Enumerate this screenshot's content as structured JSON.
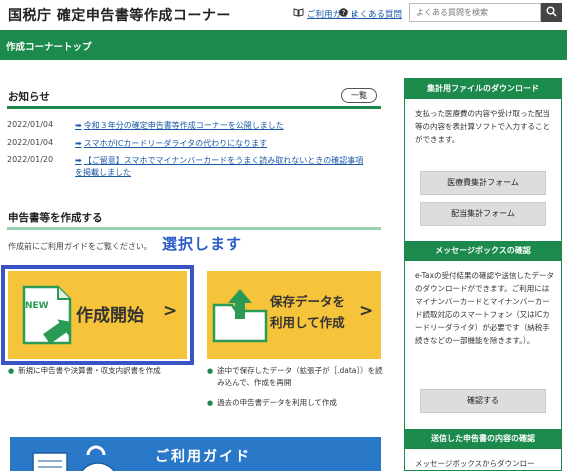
{
  "header": {
    "site_title": "国税庁 確定申告書等作成コーナー",
    "guide_link": "ご利用ガイド",
    "faq_link": "よくある質問",
    "search_placeholder": "よくある質問を検索"
  },
  "nav": {
    "title": "作成コーナートップ"
  },
  "news": {
    "title": "お知らせ",
    "more_label": "一覧",
    "items": [
      {
        "date": "2022/01/04",
        "text": "令和３年分の確定申告書等作成コーナーを公開しました"
      },
      {
        "date": "2022/01/04",
        "text": "スマホがICカードリーダライタの代わりになります"
      },
      {
        "date": "2022/01/20",
        "text": "【ご留意】スマホでマイナンバーカードをうまく読み取れないときの確認事項を掲載しました"
      }
    ]
  },
  "create": {
    "title": "申告書等を作成する",
    "note": "作成前にご利用ガイドをご覧ください。",
    "annotation": "選択します",
    "start_button": {
      "badge": "NEW",
      "label": "作成開始",
      "chevron": ">"
    },
    "resume_button": {
      "line1": "保存データを",
      "line2": "利用して作成",
      "chevron": ">"
    },
    "start_bullets": [
      "新規に申告書や決算書・収支内訳書を作成"
    ],
    "resume_bullets": [
      "途中で保存したデータ（拡張子が［.data］）を読み込んで、作成を再開",
      "過去の申告書データを利用して作成"
    ]
  },
  "guide_banner": {
    "label": "ご利用ガイド"
  },
  "sidebar": {
    "sections": [
      {
        "title": "集計用ファイルのダウンロード",
        "text": "支払った医療費の内容や受け取った配当等の内容を表計算ソフトで入力することができます。",
        "buttons": [
          "医療費集計フォーム",
          "配当集計フォーム"
        ]
      },
      {
        "title": "メッセージボックスの確認",
        "text": "e-Taxの受付結果の確認や送信したデータのダウンロードができます。ご利用にはマイナンバーカードとマイナンバーカード読取対応のスマートフォン（又はICカードリーダライタ）が必要です（納税手続きなどの一部機能を除きます。）。",
        "buttons": [
          "確認する"
        ]
      },
      {
        "title": "送信した申告書の内容の確認",
        "text": "メッセージボックスからダウンロー"
      }
    ]
  },
  "colors": {
    "brand_green": "#1b8a4c",
    "button_yellow": "#f6c43a",
    "highlight_blue": "#3a54c4"
  }
}
